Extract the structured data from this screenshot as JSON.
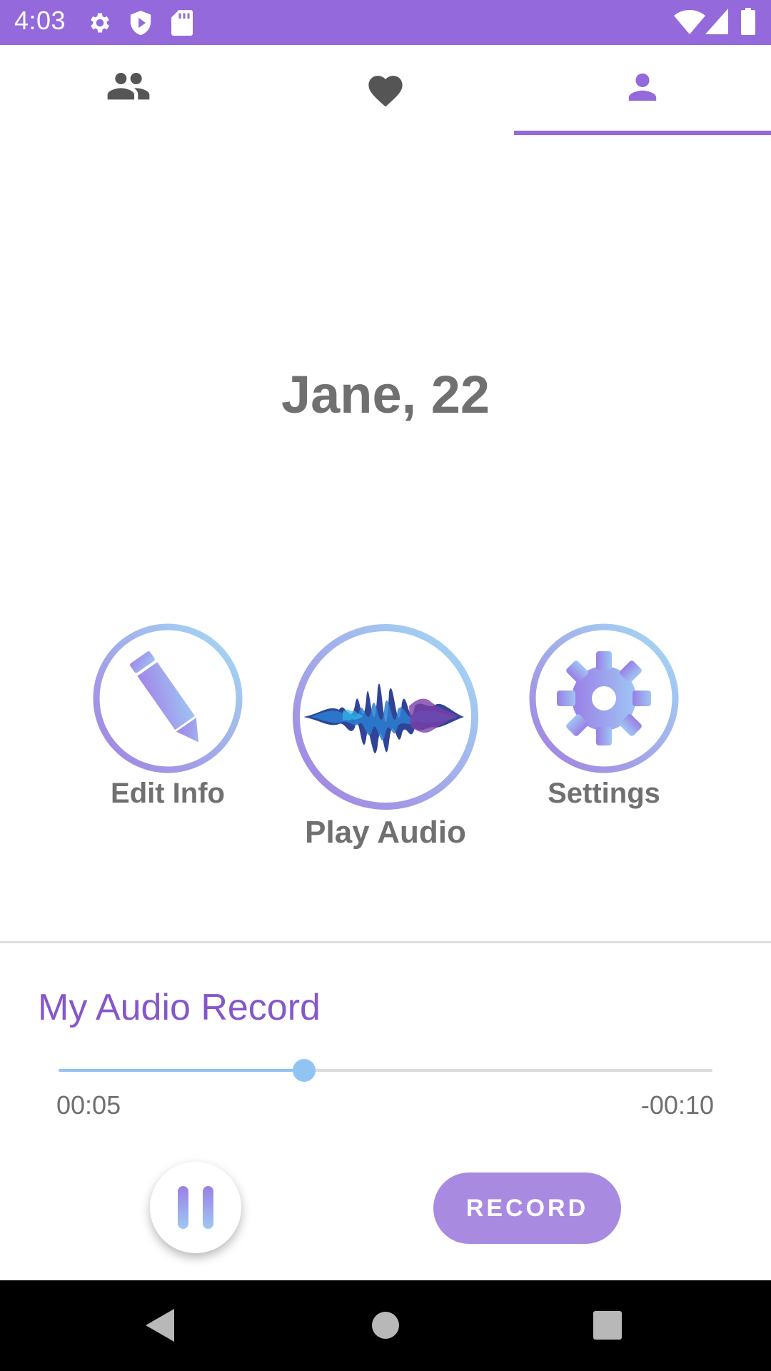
{
  "status_bar": {
    "time": "4:03",
    "color": "#9469dc",
    "icons_left": [
      "settings-icon",
      "shield-icon",
      "sd-card-icon"
    ],
    "icons_right": [
      "wifi-icon",
      "signal-icon",
      "battery-icon"
    ]
  },
  "tabs": [
    {
      "name": "people",
      "icon": "people-icon",
      "selected": false
    },
    {
      "name": "favorites",
      "icon": "heart-icon",
      "selected": false
    },
    {
      "name": "profile",
      "icon": "person-icon",
      "selected": true
    }
  ],
  "profile": {
    "name_age": "Jane, 22"
  },
  "actions": {
    "edit_info": {
      "label": "Edit Info",
      "icon": "pencil-icon"
    },
    "play_audio": {
      "label": "Play Audio",
      "icon": "soundwave-icon"
    },
    "settings": {
      "label": "Settings",
      "icon": "gear-icon"
    }
  },
  "audio_record": {
    "title": "My Audio Record",
    "elapsed": "00:05",
    "remaining": "-00:10",
    "progress": 0.375,
    "record_label": "RECORD",
    "pause_icon": "pause-icon"
  },
  "colors": {
    "accent": "#9469dc",
    "title_purple": "#8557c9",
    "slider_blue": "#90c4f3",
    "record_button": "#a98ae1",
    "text_gray": "#707070"
  }
}
